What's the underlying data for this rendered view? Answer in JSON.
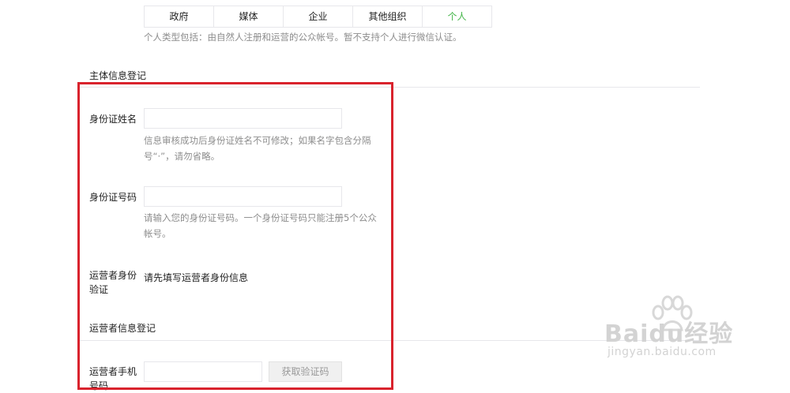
{
  "account_type": {
    "tabs": [
      "政府",
      "媒体",
      "企业",
      "其他组织",
      "个人"
    ],
    "selected": "个人",
    "hint": "个人类型包括：由自然人注册和运营的公众帐号。暂不支持个人进行微信认证。"
  },
  "subject_section": {
    "title": "主体信息登记",
    "id_name": {
      "label": "身份证姓名",
      "value": "",
      "hint_lines": [
        "信息审核成功后身份证姓名不可修改；如果名字包含分隔",
        "号“·”，请勿省略。"
      ]
    },
    "id_number": {
      "label": "身份证号码",
      "value": "",
      "hint_lines": [
        "请输入您的身份证号码。一个身份证号码只能注册5个公众",
        "帐号。"
      ]
    },
    "operator_verify": {
      "label_lines": [
        "运营者身份",
        "验证"
      ],
      "text": "请先填写运营者身份信息"
    }
  },
  "operator_section": {
    "title": "运营者信息登记",
    "phone": {
      "label_lines": [
        "运营者手机",
        "号码"
      ],
      "value": "",
      "get_code_button": "获取验证码"
    }
  },
  "watermark": {
    "brand": "Baidu经验",
    "url": "jingyan.baidu.com"
  },
  "colors": {
    "active_tab": "#44b549",
    "highlight_border": "#d9232d",
    "hint_text": "#8d8d8d",
    "border": "#e7e7eb"
  }
}
